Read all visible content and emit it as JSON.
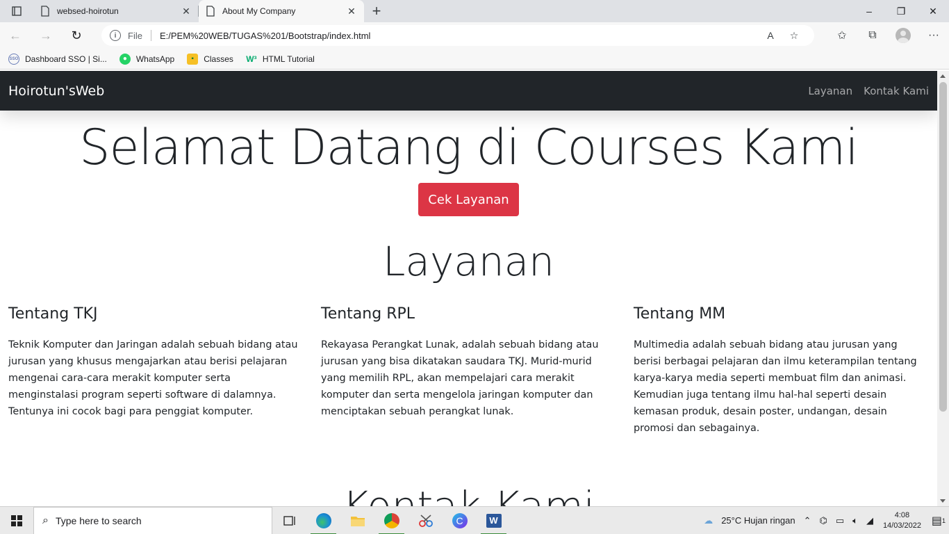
{
  "browser": {
    "tabs": [
      {
        "title": "websed-hoirotun",
        "active": false
      },
      {
        "title": "About My Company",
        "active": true
      }
    ],
    "new_tab_symbol": "+",
    "window_controls": {
      "minimize": "–",
      "restore": "❐",
      "close": "✕"
    },
    "address": {
      "scheme_label": "File",
      "url": "E:/PEM%20WEB/TUGAS%201/Bootstrap/index.html"
    },
    "bookmarks": [
      {
        "label": "Dashboard SSO | Si...",
        "icon": "sso-icon"
      },
      {
        "label": "WhatsApp",
        "icon": "whatsapp-icon"
      },
      {
        "label": "Classes",
        "icon": "classes-icon"
      },
      {
        "label": "HTML Tutorial",
        "icon": "w3schools-icon"
      }
    ]
  },
  "page": {
    "navbar": {
      "brand": "Hoirotun'sWeb",
      "links": [
        "Layanan",
        "Kontak Kami"
      ]
    },
    "hero": {
      "title": "Selamat Datang di Courses Kami",
      "button_label": "Cek Layanan"
    },
    "services": {
      "title": "Layanan",
      "columns": [
        {
          "heading": "Tentang TKJ",
          "text": "Teknik Komputer dan Jaringan adalah sebuah bidang atau jurusan yang khusus mengajarkan atau berisi pelajaran mengenai cara-cara merakit komputer serta menginstalasi program seperti software di dalamnya. Tentunya ini cocok bagi para penggiat komputer."
        },
        {
          "heading": "Tentang RPL",
          "text": "Rekayasa Perangkat Lunak, adalah sebuah bidang atau jurusan yang bisa dikatakan saudara TKJ. Murid-murid yang memilih RPL, akan mempelajari cara merakit komputer dan serta mengelola jaringan komputer dan menciptakan sebuah perangkat lunak."
        },
        {
          "heading": "Tentang MM",
          "text": "Multimedia adalah sebuah bidang atau jurusan yang berisi berbagai pelajaran dan ilmu keterampilan tentang karya-karya media seperti membuat film dan animasi. Kemudian juga tentang ilmu hal-hal seperti desain kemasan produk, desain poster, undangan, desain promosi dan sebagainya."
        }
      ]
    },
    "contact": {
      "title": "Kontak Kami"
    }
  },
  "taskbar": {
    "search_placeholder": "Type here to search",
    "weather": "25°C  Hujan ringan",
    "time": "4:08",
    "date": "14/03/2022",
    "notification_count": "1"
  },
  "colors": {
    "navbar_bg": "#212529",
    "button_danger": "#dc3545",
    "text": "#212529"
  }
}
